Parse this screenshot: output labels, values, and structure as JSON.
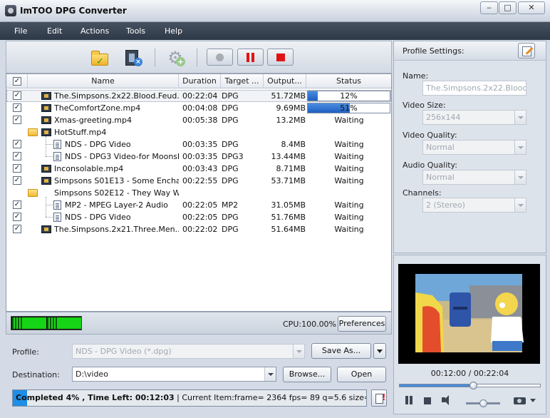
{
  "window": {
    "title": "ImTOO DPG Converter",
    "min": "‒",
    "max": "□",
    "close": "✕"
  },
  "menu": [
    "File",
    "Edit",
    "Actions",
    "Tools",
    "Help"
  ],
  "table": {
    "headers": {
      "name": "Name",
      "duration": "Duration",
      "target": "Target ...",
      "output": "Output...",
      "status": "Status"
    },
    "rows": [
      {
        "checked": true,
        "icon": "film",
        "level": 0,
        "name": "The.Simpsons.2x22.Blood.Feud....",
        "duration": "00:22:04",
        "target": "DPG",
        "output": "51.72MB",
        "status": "12%",
        "progress": 0.12,
        "selected": true
      },
      {
        "checked": true,
        "icon": "film",
        "level": 0,
        "name": "TheComfortZone.mp4",
        "duration": "00:04:08",
        "target": "DPG",
        "output": "9.69MB",
        "status": "51%",
        "progress": 0.51
      },
      {
        "checked": true,
        "icon": "film",
        "level": 0,
        "name": "Xmas-greeting.mp4",
        "duration": "00:05:38",
        "target": "DPG",
        "output": "13.2MB",
        "status": "Waiting"
      },
      {
        "checked": false,
        "icon": "folder-film",
        "level": 0,
        "name": "HotStuff.mp4",
        "duration": "",
        "target": "",
        "output": "",
        "status": ""
      },
      {
        "checked": true,
        "icon": "doc",
        "level": 1,
        "name": "NDS - DPG Video",
        "duration": "00:03:35",
        "target": "DPG",
        "output": "8.4MB",
        "status": "Waiting"
      },
      {
        "checked": true,
        "icon": "doc",
        "level": 1,
        "name": "NDS - DPG3 Video-for Moonsh...",
        "duration": "00:03:35",
        "target": "DPG3",
        "output": "13.44MB",
        "status": "Waiting"
      },
      {
        "checked": true,
        "icon": "film",
        "level": 0,
        "name": "Inconsolable.mp4",
        "duration": "00:03:43",
        "target": "DPG",
        "output": "8.71MB",
        "status": "Waiting"
      },
      {
        "checked": true,
        "icon": "film",
        "level": 0,
        "name": "Simpsons S01E13 - Some Enchan...",
        "duration": "00:22:55",
        "target": "DPG",
        "output": "53.71MB",
        "status": "Waiting"
      },
      {
        "checked": false,
        "icon": "folder",
        "level": 0,
        "name": "Simpsons S02E12 - They Way W...",
        "duration": "",
        "target": "",
        "output": "",
        "status": ""
      },
      {
        "checked": true,
        "icon": "doc",
        "level": 1,
        "name": "MP2 - MPEG Layer-2 Audio",
        "duration": "00:22:05",
        "target": "MP2",
        "output": "31.05MB",
        "status": "Waiting"
      },
      {
        "checked": true,
        "icon": "doc",
        "level": 1,
        "name": "NDS - DPG Video",
        "duration": "00:22:05",
        "target": "DPG",
        "output": "51.76MB",
        "status": "Waiting"
      },
      {
        "checked": true,
        "icon": "film",
        "level": 0,
        "name": "The.Simpsons.2x21.Three.Men....",
        "duration": "00:22:02",
        "target": "DPG",
        "output": "51.64MB",
        "status": "Waiting"
      }
    ]
  },
  "cpu": {
    "text": "CPU:100.00%"
  },
  "buttons": {
    "preferences": "Preferences",
    "save_as": "Save As...",
    "browse": "Browse...",
    "open": "Open"
  },
  "profile": {
    "label": "Profile:",
    "value": "NDS - DPG Video (*.dpg)"
  },
  "destination": {
    "label": "Destination:",
    "value": "D:\\video"
  },
  "status": {
    "bold": "Completed 4% , Time Left: 00:12:03",
    "rest": " | Current Item:frame= 2364 fps= 89 q=5.6 size=6267kB...",
    "progress": 0.04
  },
  "settings": {
    "header": "Profile Settings:",
    "name_label": "Name:",
    "name_value": "The.Simpsons.2x22.Blood.Feud",
    "video_size_label": "Video Size:",
    "video_size_value": "256x144",
    "video_quality_label": "Video Quality:",
    "video_quality_value": "Normal",
    "audio_quality_label": "Audio Quality:",
    "audio_quality_value": "Normal",
    "channels_label": "Channels:",
    "channels_value": "2 (Stereo)"
  },
  "preview": {
    "time": "00:12:00 / 00:22:04",
    "seek": 0.53,
    "volume": 0.5
  }
}
